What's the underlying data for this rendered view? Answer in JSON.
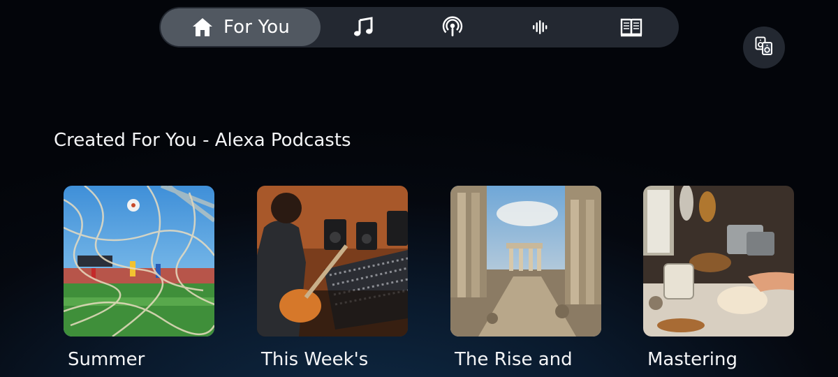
{
  "nav": {
    "items": [
      {
        "label": "For You",
        "icon": "home-icon",
        "active": true
      },
      {
        "label": "",
        "icon": "music-note-icon",
        "active": false
      },
      {
        "label": "",
        "icon": "podcast-icon",
        "active": false
      },
      {
        "label": "",
        "icon": "audio-waveform-icon",
        "active": false
      },
      {
        "label": "",
        "icon": "book-icon",
        "active": false
      }
    ]
  },
  "cast_button": {
    "icon": "speaker-group-icon"
  },
  "section": {
    "title": "Created For You - Alexa Podcasts",
    "cards": [
      {
        "title": "Summer",
        "art": "soccer-goal-net"
      },
      {
        "title": "This Week's",
        "art": "guitarist-studio"
      },
      {
        "title": "The Rise and",
        "art": "roman-ruins"
      },
      {
        "title": "Mastering",
        "art": "baking-kitchen"
      }
    ]
  },
  "colors": {
    "background": "#05080f",
    "pill": "#3b4350",
    "text": "#f4f5f7"
  }
}
